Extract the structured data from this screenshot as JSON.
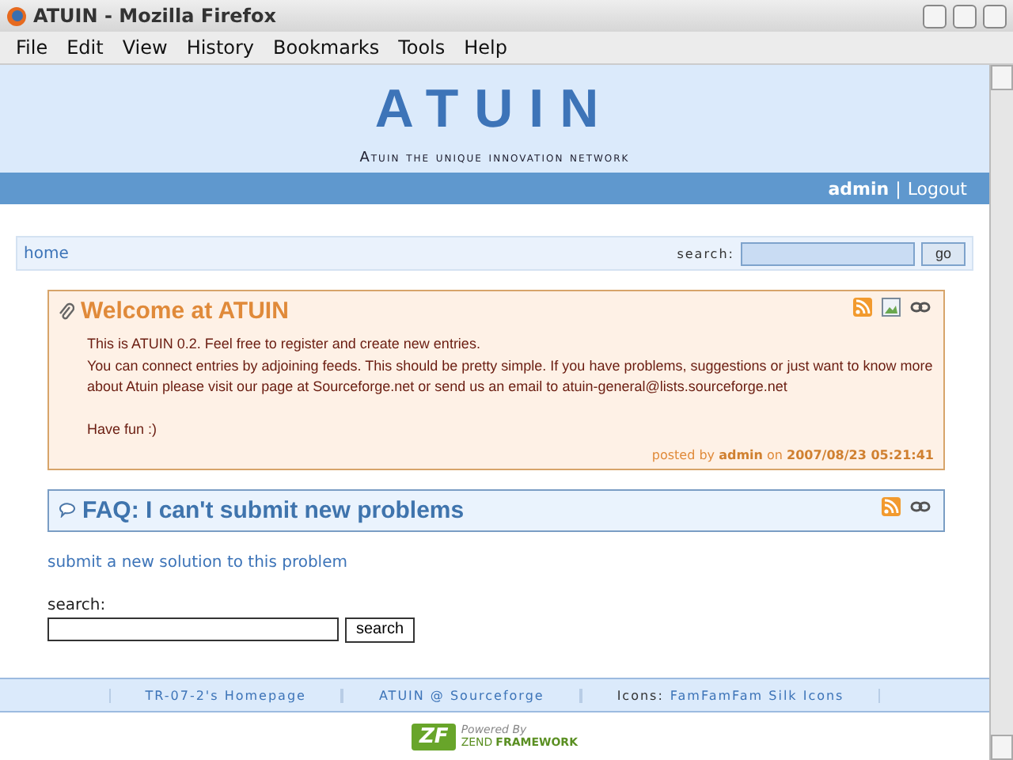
{
  "window": {
    "title": "ATUIN - Mozilla Firefox"
  },
  "menu": [
    "File",
    "Edit",
    "View",
    "History",
    "Bookmarks",
    "Tools",
    "Help"
  ],
  "header": {
    "title": "ATUIN",
    "tagline": "Atuin the unique innovation network"
  },
  "user_bar": {
    "user": "admin",
    "separator": "|",
    "logout": "Logout"
  },
  "nav": {
    "home": "home",
    "search_label": "search:",
    "go": "go"
  },
  "entries": [
    {
      "kind": "welcome",
      "title": "Welcome at ATUIN",
      "body": [
        "This is ATUIN 0.2. Feel free to register and create new entries.",
        "You can connect entries by adjoining feeds. This should be pretty simple. If you have problems, suggestions or just want to know more about Atuin please visit our page at Sourceforge.net or send us an email to atuin-general@lists.sourceforge.net"
      ],
      "closing": "Have fun :)",
      "posted_by": "posted by",
      "author": "admin",
      "on": "on",
      "date": "2007/08/23 05:21:41",
      "icons": [
        {
          "kind": "feed"
        },
        {
          "kind": "image"
        },
        {
          "kind": "link"
        }
      ]
    },
    {
      "kind": "faq",
      "title": "FAQ: I can't submit new problems",
      "icons": [
        {
          "kind": "feed"
        },
        {
          "kind": "link"
        }
      ]
    }
  ],
  "submit_link": "submit a new solution to this problem",
  "search": {
    "label": "search:",
    "button": "search"
  },
  "footer": {
    "links": [
      {
        "text": "TR-07-2's Homepage"
      },
      {
        "text": "ATUIN @ Sourceforge"
      },
      {
        "prefix": "Icons:",
        "text": "FamFamFam Silk Icons"
      }
    ]
  },
  "powered": {
    "logo": "ZF",
    "line1": "Powered By",
    "line2a": "ZEND",
    "line2b": "FRAMEWORK"
  }
}
